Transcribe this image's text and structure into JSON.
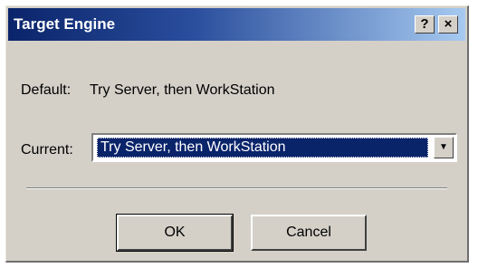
{
  "window": {
    "title": "Target Engine",
    "help_label": "?",
    "close_label": "×"
  },
  "default": {
    "label": "Default:",
    "value": "Try Server, then WorkStation"
  },
  "current": {
    "label": "Current:",
    "selected": "Try Server, then WorkStation",
    "arrow": "▼"
  },
  "buttons": {
    "ok_label": "OK",
    "cancel_label": "Cancel"
  },
  "colors": {
    "titlebar_start": "#0a246a",
    "titlebar_end": "#a6caf0",
    "selection": "#0a246a",
    "face": "#d4d0c8"
  }
}
